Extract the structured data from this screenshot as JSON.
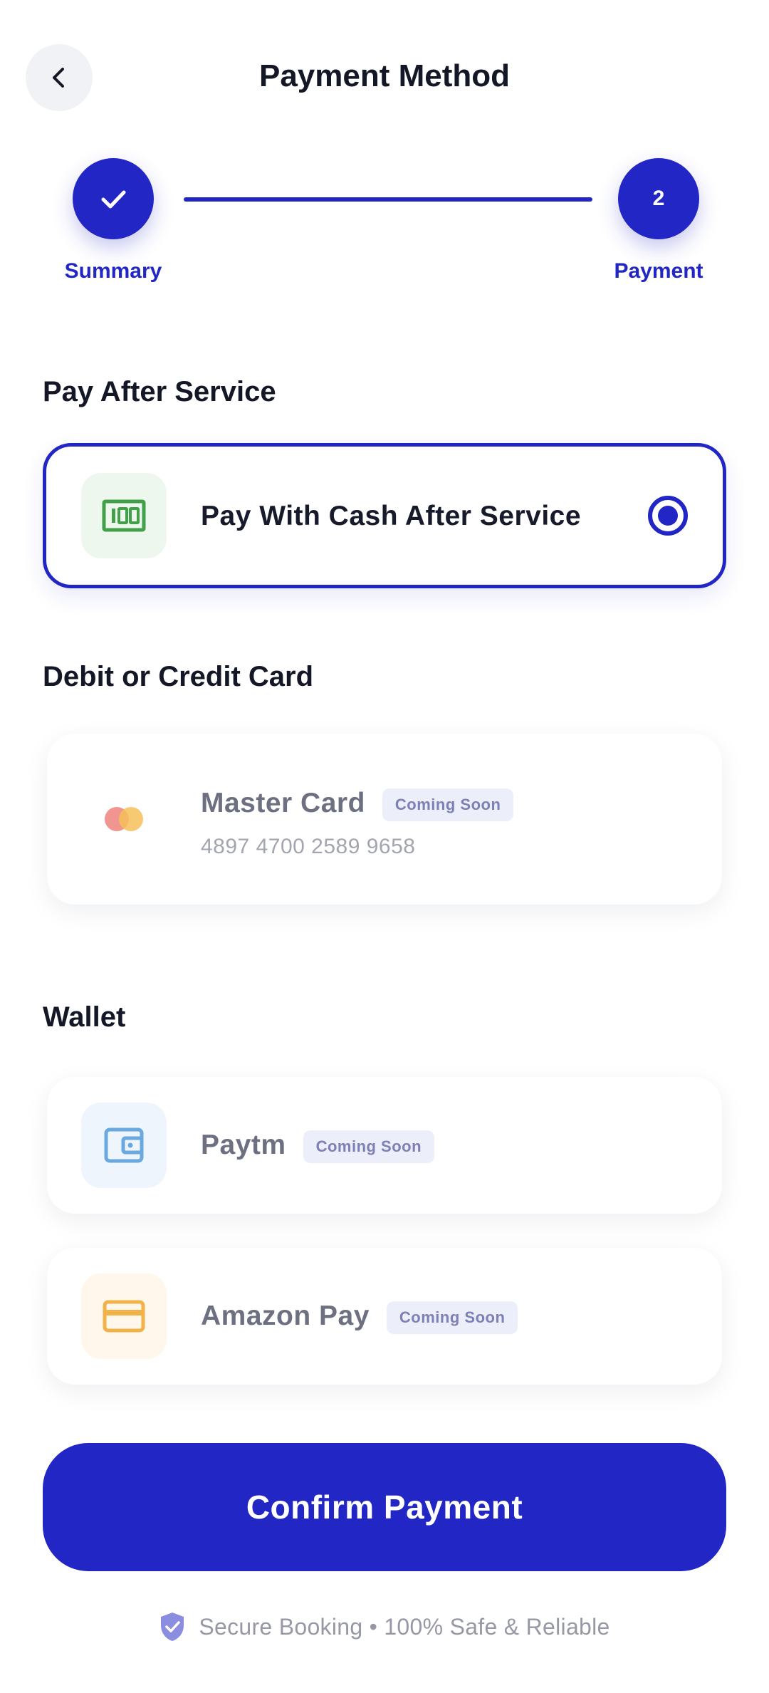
{
  "header": {
    "title": "Payment Method",
    "back_icon": "chevron-left-icon"
  },
  "stepper": {
    "steps": [
      {
        "label": "Summary",
        "state": "completed",
        "icon": "check-icon"
      },
      {
        "label": "Payment",
        "state": "active",
        "number": "2"
      }
    ]
  },
  "sections": {
    "pay_after": {
      "title": "Pay After Service",
      "option": {
        "label": "Pay With Cash After Service",
        "icon": "cash-icon",
        "selected": true
      }
    },
    "card": {
      "title": "Debit or Credit Card",
      "option": {
        "label": "Master Card",
        "badge": "Coming Soon",
        "number": "4897 4700 2589 9658",
        "icon": "mastercard-icon"
      }
    },
    "wallet": {
      "title": "Wallet",
      "options": [
        {
          "label": "Paytm",
          "badge": "Coming Soon",
          "icon": "wallet-icon"
        },
        {
          "label": "Amazon Pay",
          "badge": "Coming Soon",
          "icon": "credit-card-icon"
        }
      ]
    }
  },
  "confirm_button": {
    "label": "Confirm Payment"
  },
  "footer": {
    "secure_text": "Secure Booking • 100% Safe & Reliable",
    "icon": "shield-check-icon"
  },
  "colors": {
    "primary": "#2226c4",
    "badge_bg": "#eceef9",
    "cash_green": "#43a04a",
    "wallet_blue": "#6aa9e0",
    "amazon_orange": "#f2b24a"
  }
}
